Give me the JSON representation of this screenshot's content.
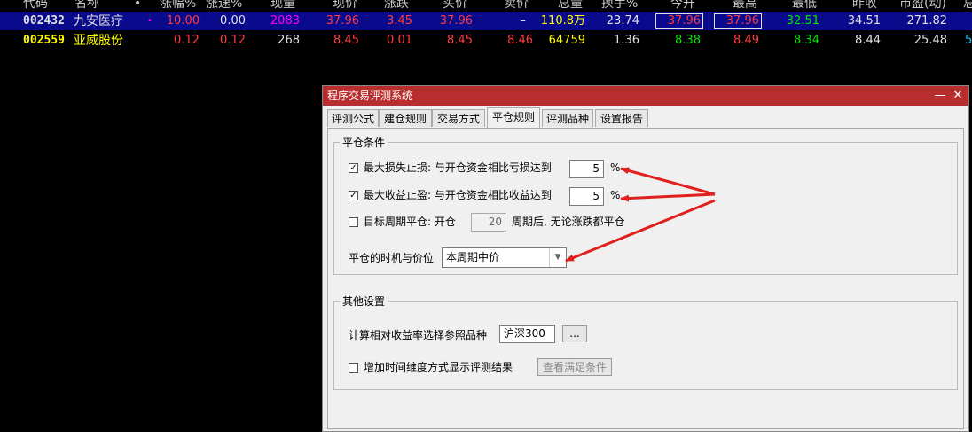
{
  "table": {
    "headers": [
      "代码",
      "名称",
      "•",
      "涨幅%",
      "涨速%",
      "现量",
      "现价",
      "涨跌",
      "买价",
      "卖价",
      "总量",
      "换手%",
      "今开",
      "最高",
      "最低",
      "昨收",
      "市盈(动)",
      "总"
    ],
    "rows": [
      {
        "code": "002432",
        "name": "九安医疗",
        "mark": "•",
        "pct": "10.00",
        "speed": "0.00",
        "vol": "2083",
        "price": "37.96",
        "chg": "3.45",
        "bid": "37.96",
        "ask": "–",
        "total": "110.8万",
        "turnover": "23.74",
        "open": "37.96",
        "high": "37.96",
        "low": "32.51",
        "prev": "34.51",
        "pe": "271.82",
        "extra": ""
      },
      {
        "code": "002559",
        "name": "亚威股份",
        "mark": "",
        "pct": "0.12",
        "speed": "0.12",
        "vol": "268",
        "price": "8.45",
        "chg": "0.01",
        "bid": "8.45",
        "ask": "8.46",
        "total": "64759",
        "turnover": "1.36",
        "open": "8.38",
        "high": "8.49",
        "low": "8.34",
        "prev": "8.44",
        "pe": "25.48",
        "extra": "5"
      }
    ]
  },
  "dialog": {
    "title": "程序交易评测系统",
    "min_glyph": "—",
    "close_glyph": "✕",
    "tabs": [
      "评测公式",
      "建仓规则",
      "交易方式",
      "平仓规则",
      "评测品种",
      "设置报告"
    ],
    "active_tab": "平仓规则",
    "close_group": {
      "title": "平仓条件",
      "stop_loss": {
        "label": "最大损失止损: 与开仓资金相比亏损达到",
        "checked": true,
        "value": "5",
        "unit": "%"
      },
      "take_profit": {
        "label": "最大收益止盈: 与开仓资金相比收益达到",
        "checked": true,
        "value": "5",
        "unit": "%"
      },
      "target_period": {
        "label": "目标周期平仓: 开仓",
        "checked": false,
        "value": "20",
        "suffix": "周期后, 无论涨跌都平仓"
      },
      "timing": {
        "label": "平仓的时机与价位",
        "selected": "本周期中价"
      }
    },
    "other_group": {
      "title": "其他设置",
      "benchmark_label": "计算相对收益率选择参照品种",
      "benchmark_value": "沪深300",
      "browse_label": "...",
      "time_dim": {
        "label": "增加时间维度方式显示评测结果",
        "checked": false
      },
      "view_btn": "查看满足条件"
    }
  },
  "check_glyph": "✓",
  "colors": {
    "red": "#ff3c3c",
    "green": "#00e600",
    "yellow": "#ffff00",
    "magenta": "#ff00ff",
    "white": "#e0e0e0",
    "arrow": "#e0201e",
    "dialog_title": "#b82e2e"
  }
}
